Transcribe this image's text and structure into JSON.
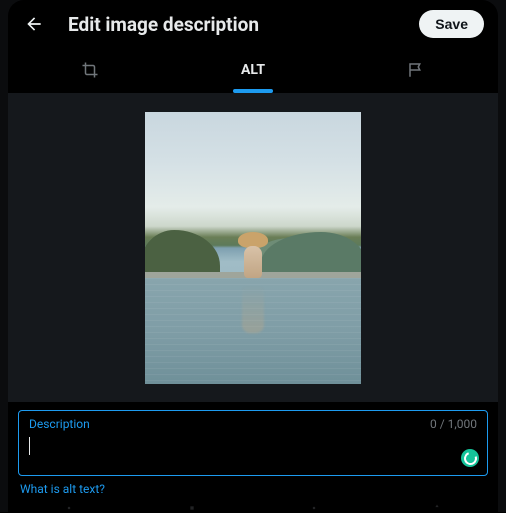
{
  "header": {
    "title": "Edit image description",
    "save_label": "Save"
  },
  "tabs": {
    "crop_icon": "crop-icon",
    "alt_label": "ALT",
    "tag_icon": "flag-icon"
  },
  "description": {
    "label": "Description",
    "value": "",
    "placeholder": "",
    "counter": "0 / 1,000"
  },
  "help_link": "What is alt text?"
}
